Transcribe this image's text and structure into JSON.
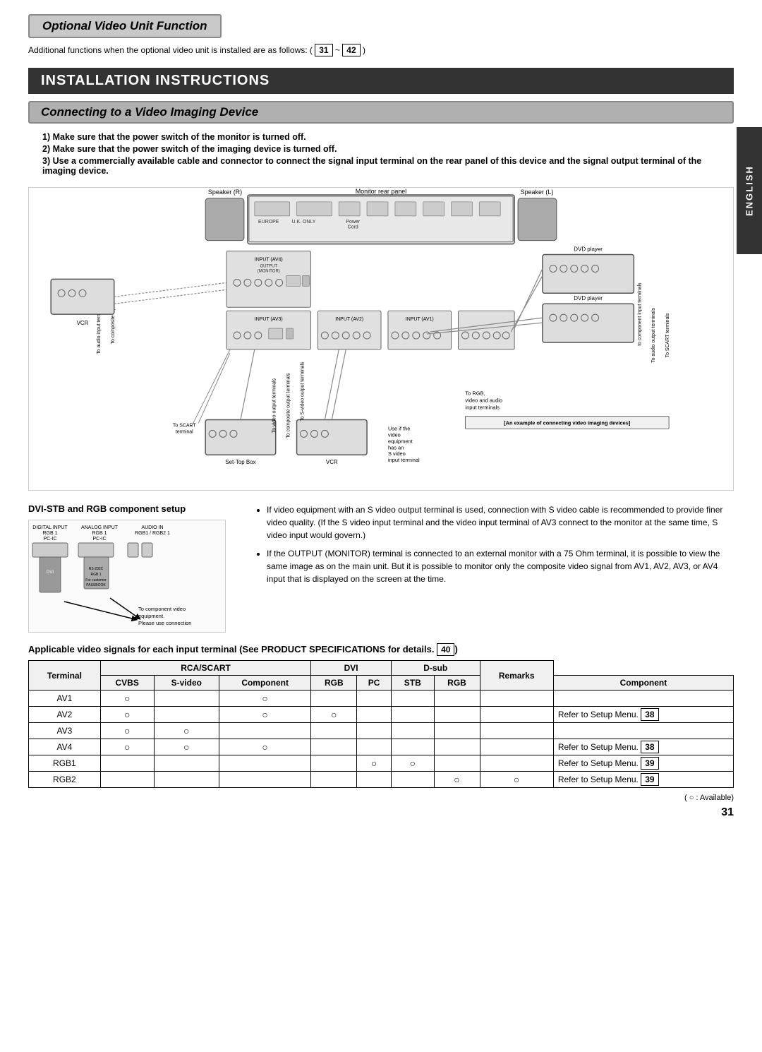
{
  "page": {
    "optional_header": "Optional Video Unit Function",
    "subtitle": "Additional functions when the optional video unit is installed are as follows:",
    "subtitle_from": "31",
    "subtitle_to": "42",
    "install_header": "INSTALLATION INSTRUCTIONS",
    "connecting_header": "Connecting to a Video Imaging Device",
    "instructions": [
      {
        "num": "1",
        "text": "Make sure that the power switch of the monitor is turned off."
      },
      {
        "num": "2",
        "text": "Make sure that the power switch of the imaging device is turned off."
      },
      {
        "num": "3",
        "text": "Use a commercially available cable and connector to connect the signal input terminal on the rear panel of this device and the signal output terminal of the imaging device."
      }
    ],
    "dvi_title": "DVI-STB and RGB component setup",
    "dvi_caption": "To component video equipment.\nPlease use connection cable suitable for the terminal form of video equipment.",
    "bullet_notes": [
      "If video equipment with an S video output terminal is used, connection with S video cable is recommended to provide finer video quality. (If the S video input terminal and the video input terminal of AV3 connect to the monitor at the same time, S video input would govern.)",
      "If the OUTPUT (MONITOR) terminal is connected to an external monitor with a 75 Ohm terminal, it is possible to view the same image as on the main unit. But it is possible to monitor only the composite video signal from AV1, AV2, AV3, or AV4 input that is displayed on the screen at the time."
    ],
    "applicable_label": "Applicable video signals for each input terminal",
    "applicable_see": "See PRODUCT SPECIFICATIONS for details.",
    "applicable_num": "40",
    "table": {
      "headers": [
        "Terminal",
        "RCA/SCART",
        "",
        "",
        "DVI",
        "",
        "D-sub",
        "",
        "Remarks"
      ],
      "subheaders": [
        "",
        "CVBS",
        "S-video",
        "Component",
        "RGB",
        "PC",
        "STB",
        "RGB",
        "Component",
        ""
      ],
      "rows": [
        {
          "terminal": "AV1",
          "cvbs": "○",
          "svideo": "",
          "component": "○",
          "rgb": "",
          "pc": "",
          "stb": "",
          "d_rgb": "",
          "d_comp": "",
          "remarks": ""
        },
        {
          "terminal": "AV2",
          "cvbs": "○",
          "svideo": "",
          "component": "○",
          "rgb": "○",
          "pc": "",
          "stb": "",
          "d_rgb": "",
          "d_comp": "",
          "remarks": "Refer to Setup Menu. 38"
        },
        {
          "terminal": "AV3",
          "cvbs": "○",
          "svideo": "○",
          "component": "",
          "rgb": "",
          "pc": "",
          "stb": "",
          "d_rgb": "",
          "d_comp": "",
          "remarks": ""
        },
        {
          "terminal": "AV4",
          "cvbs": "○",
          "svideo": "○",
          "component": "○",
          "rgb": "",
          "pc": "",
          "stb": "",
          "d_rgb": "",
          "d_comp": "",
          "remarks": "Refer to Setup Menu. 38"
        },
        {
          "terminal": "RGB1",
          "cvbs": "",
          "svideo": "",
          "component": "",
          "rgb": "",
          "pc": "○",
          "stb": "○",
          "d_rgb": "",
          "d_comp": "",
          "remarks": "Refer to Setup Menu. 39"
        },
        {
          "terminal": "RGB2",
          "cvbs": "",
          "svideo": "",
          "component": "",
          "rgb": "",
          "pc": "",
          "stb": "",
          "d_rgb": "○",
          "d_comp": "○",
          "remarks": "Refer to Setup Menu. 39"
        }
      ]
    },
    "footnote": "( ○ : Available)",
    "page_number": "31",
    "english_label": "ENGLISH",
    "diagram_labels": {
      "monitor_rear": "Monitor rear panel",
      "speaker_r": "Speaker (R)",
      "speaker_l": "Speaker (L)",
      "vcr_left": "VCR",
      "dvd_player1": "DVD player",
      "dvd_player2": "DVD player",
      "vcr_right": "VCR",
      "set_top_box": "Set-Top Box",
      "europe": "EUROPE",
      "uk_only": "U.K. ONLY",
      "to_scart": "To SCART terminal",
      "to_composite": "To composite input terminal",
      "to_audio": "To audio input terminals",
      "to_svideo_output": "To S-video output terminals",
      "to_composite_output": "To composite output terminals",
      "to_svideo_rgb": "To RGB, video and audio input terminals",
      "to_component": "to component input terminals",
      "to_audio_output": "To audio output terminals",
      "to_scart_terminals": "To SCART terminals",
      "example_label": "[An example of connecting video imaging devices]",
      "use_if": "Use if the video equipment has an S video input terminal",
      "input_av4": "INPUT (AV4)",
      "input_av3": "INPUT (AV3)",
      "input_av2": "INPUT (AV2)",
      "input_av1": "INPUT (AV1)",
      "output_monitor": "OUTPUT (MONITOR)",
      "scart": "SCART"
    }
  }
}
